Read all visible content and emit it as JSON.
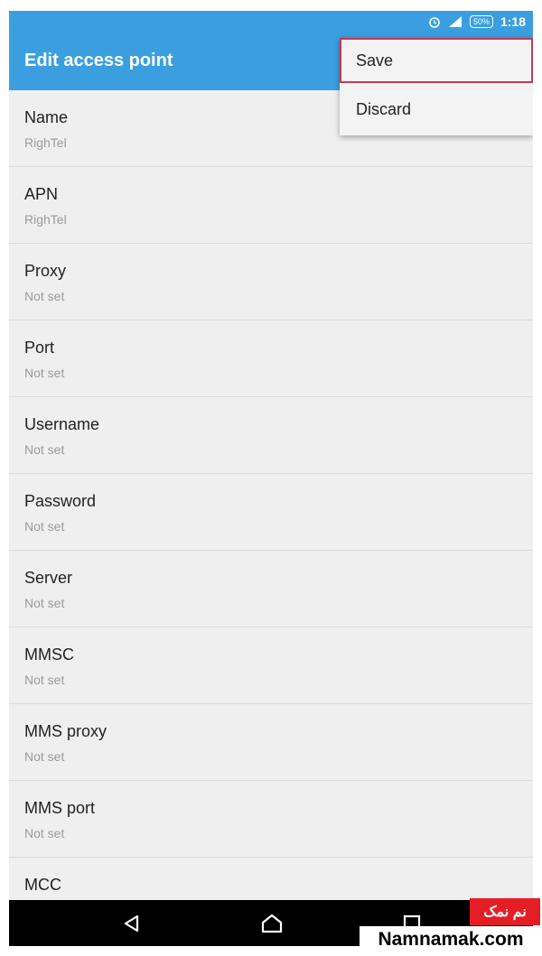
{
  "status_bar": {
    "time": "1:18",
    "battery": "50%",
    "icons": [
      "alarm-icon",
      "signal-icon",
      "battery-icon"
    ]
  },
  "app_bar": {
    "title": "Edit access point"
  },
  "menu": {
    "items": [
      {
        "label": "Save",
        "selected": true
      },
      {
        "label": "Discard",
        "selected": false
      }
    ],
    "highlight_color": "#c73a50"
  },
  "settings": {
    "items": [
      {
        "label": "Name",
        "value": "RighTel"
      },
      {
        "label": "APN",
        "value": "RighTel"
      },
      {
        "label": "Proxy",
        "value": "Not set"
      },
      {
        "label": "Port",
        "value": "Not set"
      },
      {
        "label": "Username",
        "value": "Not set"
      },
      {
        "label": "Password",
        "value": "Not set"
      },
      {
        "label": "Server",
        "value": "Not set"
      },
      {
        "label": "MMSC",
        "value": "Not set"
      },
      {
        "label": "MMS proxy",
        "value": "Not set"
      },
      {
        "label": "MMS port",
        "value": "Not set"
      },
      {
        "label": "MCC",
        "value": ""
      }
    ]
  },
  "nav_bar": {
    "buttons": [
      "back-icon",
      "home-icon",
      "recents-icon"
    ]
  },
  "watermark": {
    "label_fa": "نم نمک",
    "site": "Namnamak.com"
  },
  "colors": {
    "accent": "#3b9fdf",
    "background": "#efefef",
    "watermark_red": "#e51e25"
  }
}
